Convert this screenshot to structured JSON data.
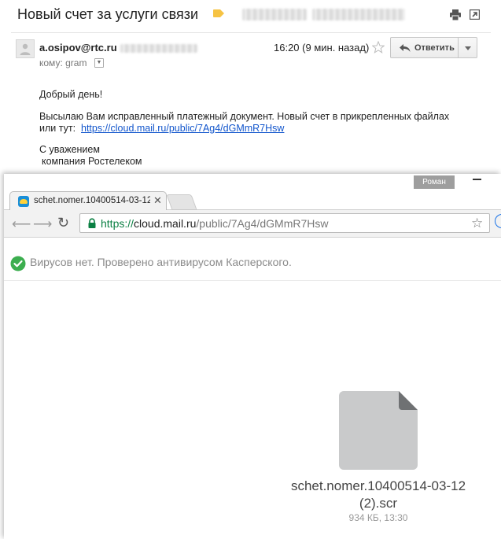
{
  "email": {
    "subject": "Новый счет за услуги связи",
    "sender": "a.osipov@rtc.ru",
    "to_label": "кому:",
    "to_value": "gram",
    "time": "16:20 (9 мин. назад)",
    "reply_label": "Ответить",
    "body": {
      "greeting": "Добрый день!",
      "line1": "Высылаю Вам исправленный платежный документ. Новый счет в прикрепленных файлах",
      "line2_prefix": "или тут:",
      "link": "https://cloud.mail.ru/public/7Ag4/dGMmR7Hsw",
      "sign1": "С уважением",
      "sign2": "компания Ростелеком"
    }
  },
  "browser": {
    "profile": "Роман",
    "tab_title": "schet.nomer.10400514-03-12",
    "url": {
      "proto": "https://",
      "host": "cloud.mail.ru",
      "path": "/public/7Ag4/dGMmR7Hsw"
    },
    "virus_status": "Вирусов нет. Проверено антивирусом Касперского.",
    "file": {
      "name_line1": "schet.nomer.10400514-03-12",
      "name_line2": "(2).scr",
      "meta": "934 КБ, 13:30"
    }
  },
  "colors": {
    "link": "#1155cc",
    "secure": "#0b8043",
    "check": "#3cae4f",
    "label": "#f6c343",
    "file_icon": "#c9cacb"
  }
}
